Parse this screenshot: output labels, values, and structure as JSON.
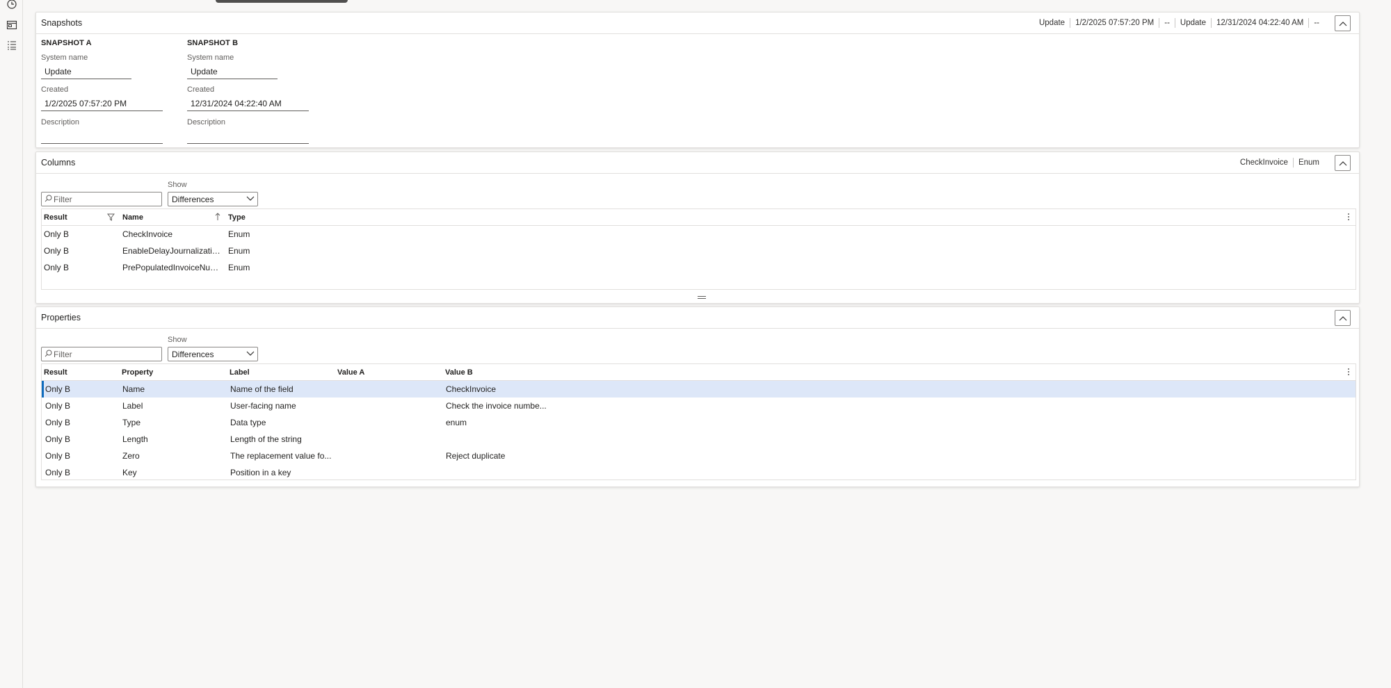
{
  "snapshots": {
    "title": "Snapshots",
    "summary": [
      "Update",
      "1/2/2025 07:57:20 PM",
      "--",
      "Update",
      "12/31/2024 04:22:40 AM",
      "--"
    ],
    "a": {
      "heading": "SNAPSHOT A",
      "system_name_label": "System name",
      "system_name": "Update",
      "created_label": "Created",
      "created": "1/2/2025 07:57:20 PM",
      "description_label": "Description",
      "description": ""
    },
    "b": {
      "heading": "SNAPSHOT B",
      "system_name_label": "System name",
      "system_name": "Update",
      "created_label": "Created",
      "created": "12/31/2024 04:22:40 AM",
      "description_label": "Description",
      "description": ""
    }
  },
  "columns": {
    "title": "Columns",
    "summary": [
      "CheckInvoice",
      "Enum"
    ],
    "filter_placeholder": "Filter",
    "show_label": "Show",
    "show_value": "Differences",
    "headers": [
      "Result",
      "Name",
      "Type"
    ],
    "rows": [
      [
        "Only B",
        "CheckInvoice",
        "Enum"
      ],
      [
        "Only B",
        "EnableDelayJournalizatio...",
        "Enum"
      ],
      [
        "Only B",
        "PrePopulatedInvoiceNum...",
        "Enum"
      ]
    ]
  },
  "properties": {
    "title": "Properties",
    "filter_placeholder": "Filter",
    "show_label": "Show",
    "show_value": "Differences",
    "headers": [
      "Result",
      "Property",
      "Label",
      "Value A",
      "Value B"
    ],
    "rows": [
      [
        "Only B",
        "Name",
        "Name of the field",
        "",
        "CheckInvoice"
      ],
      [
        "Only B",
        "Label",
        "User-facing name",
        "",
        "Check the invoice numbe..."
      ],
      [
        "Only B",
        "Type",
        "Data type",
        "",
        "enum"
      ],
      [
        "Only B",
        "Length",
        "Length of the string",
        "",
        ""
      ],
      [
        "Only B",
        "Zero",
        "The replacement value fo...",
        "",
        "Reject duplicate"
      ],
      [
        "Only B",
        "Key",
        "Position in a key",
        "",
        ""
      ]
    ]
  }
}
